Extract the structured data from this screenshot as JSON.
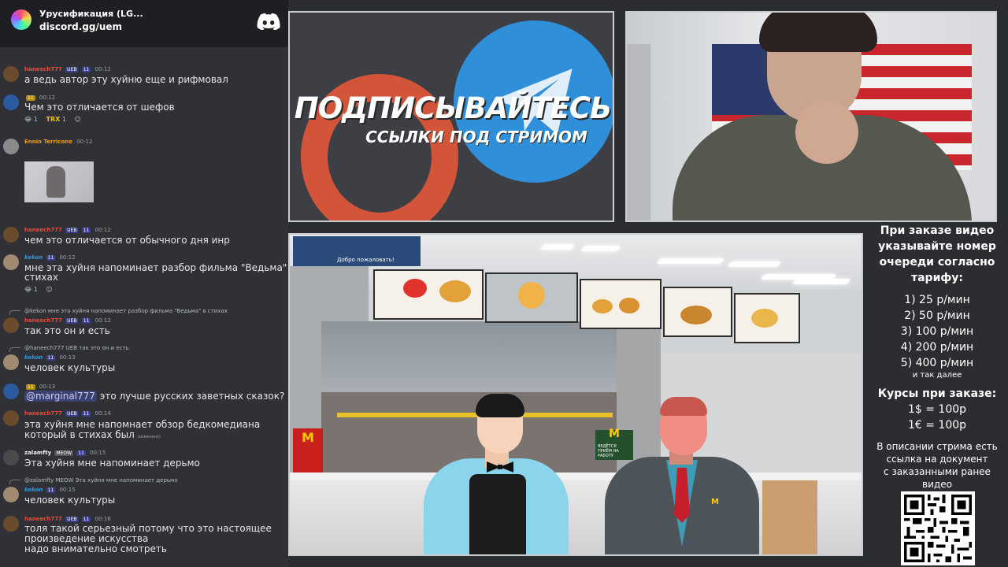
{
  "discord": {
    "server_name": "Урусификация (LG...",
    "invite_link": "discord.gg/uem"
  },
  "messages": [
    {
      "user": "haneech777",
      "badges": [
        "UEB",
        "11"
      ],
      "time": "00:12",
      "text": "а ведь автор эту хуйню еще и рифмовал",
      "user_color": "#e74c3c"
    },
    {
      "user": "",
      "badges": [
        "11"
      ],
      "time": "00:12",
      "text": "Чем это отличается от шефов",
      "user_color": "#f1c40f",
      "reactions": [
        {
          "emoji": "😂",
          "count": "1"
        },
        {
          "emoji": "TRX",
          "count": "1"
        }
      ]
    },
    {
      "user": "Ennio Terricone",
      "badges": [],
      "time": "00:12",
      "text": "",
      "user_color": "#f39c12"
    },
    {
      "user": "haneech777",
      "badges": [
        "UEB",
        "11"
      ],
      "time": "00:12",
      "text": "чем это отличается от обычного дня инр",
      "user_color": "#e74c3c"
    },
    {
      "user": "kekon",
      "badges": [
        "11"
      ],
      "time": "00:12",
      "text_lines": [
        "мне эта хуйня напоминает разбор фильма \"Ведьма\" в",
        "стихах"
      ],
      "user_color": "#3498db",
      "reactions": [
        {
          "emoji": "😂",
          "count": "1"
        }
      ]
    },
    {
      "reply": "@kekon мне эта хуйня напоминает разбор фильма \"Ведьма\" в стихах",
      "user": "haneech777",
      "badges": [
        "UEB",
        "11"
      ],
      "time": "00:12",
      "text": "так это он и есть",
      "user_color": "#e74c3c"
    },
    {
      "reply": "@haneech777 UEB так это он и есть",
      "user": "kekon",
      "badges": [
        "11"
      ],
      "time": "00:13",
      "text": "человек культуры",
      "user_color": "#3498db"
    },
    {
      "user": "",
      "badges": [
        "11"
      ],
      "time": "00:13",
      "mention": "@marginal777",
      "text": "это лучше русских заветных сказок?",
      "user_color": "#f1c40f"
    },
    {
      "user": "haneech777",
      "badges": [
        "UEB",
        "11"
      ],
      "time": "00:14",
      "text_lines": [
        "эта хуйня мне напомнает обзор бедкомедиана",
        "который в стихах был"
      ],
      "edited": "(изменено)",
      "user_color": "#e74c3c"
    },
    {
      "user": "zalamfty",
      "badges": [
        "MEOW",
        "11"
      ],
      "time": "00:15",
      "text": "Эта хуйня мне напоминает дерьмо",
      "user_color": "#ecf0f1"
    },
    {
      "reply": "@zalamfty MEOW Эта хуйня мне напоминает дерьмо",
      "user": "kekon",
      "badges": [
        "11"
      ],
      "time": "00:15",
      "text": "человек культуры",
      "user_color": "#3498db"
    },
    {
      "user": "haneech777",
      "badges": [
        "UEB",
        "11"
      ],
      "time": "00:16",
      "text_lines": [
        "толя такой серьезный потому что это настоящее",
        "произведение искусства",
        "надо внимательно смотреть"
      ],
      "user_color": "#e74c3c"
    }
  ],
  "promo": {
    "title": "ПОДПИСЫВАЙТЕСЬ",
    "subtitle": "ССЫЛКИ ПОД СТРИМОМ"
  },
  "scene": {
    "menu_left_text": "Добро пожаловать!",
    "mc_logo": "M",
    "promo_sign_text": "ВЕДЁТСЯ ПРИЁМ НА РАБОТУ",
    "manager_badge": "M"
  },
  "info": {
    "order_lines": [
      "При заказе видео",
      "указывайте номер",
      "очереди согласно",
      "тарифу:"
    ],
    "tariffs": [
      "1) 25 р/мин",
      "2) 50 р/мин",
      "3) 100 р/мин",
      "4) 200 р/мин",
      "5) 400 р/мин"
    ],
    "etc": "и так далее",
    "rates_title": "Курсы при заказе:",
    "rates": [
      "1$ = 100р",
      "1€ = 100р"
    ],
    "desc_lines": [
      "В описании стрима есть",
      "ссылка на документ",
      "с заказанными ранее",
      "видео"
    ]
  },
  "colors": {
    "discord_bg": "#2f3136",
    "discord_header": "#1e1f22",
    "telegram_blue": "#2f8fd8",
    "rutube_orange": "#d2553a",
    "mc_red": "#c8201c",
    "mc_yellow": "#ffcc00"
  }
}
